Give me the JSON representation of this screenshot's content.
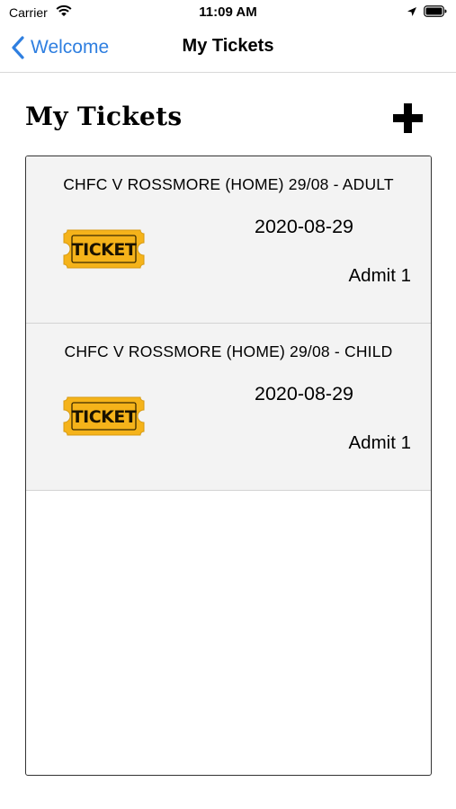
{
  "status_bar": {
    "carrier": "Carrier",
    "time": "11:09 AM"
  },
  "nav": {
    "back_label": "Welcome",
    "title": "My Tickets"
  },
  "header": {
    "title": "My Tickets",
    "add_icon": "plus-icon"
  },
  "tickets": [
    {
      "name": "CHFC V ROSSMORE (HOME) 29/08 - ADULT",
      "date": "2020-08-29",
      "admit": "Admit 1",
      "icon_text": "TICKET"
    },
    {
      "name": "CHFC V ROSSMORE (HOME) 29/08 - CHILD",
      "date": "2020-08-29",
      "admit": "Admit 1",
      "icon_text": "TICKET"
    }
  ],
  "colors": {
    "accent": "#2f7fe0",
    "ticket_fill": "#f5b31a",
    "row_bg": "#f3f3f3"
  }
}
